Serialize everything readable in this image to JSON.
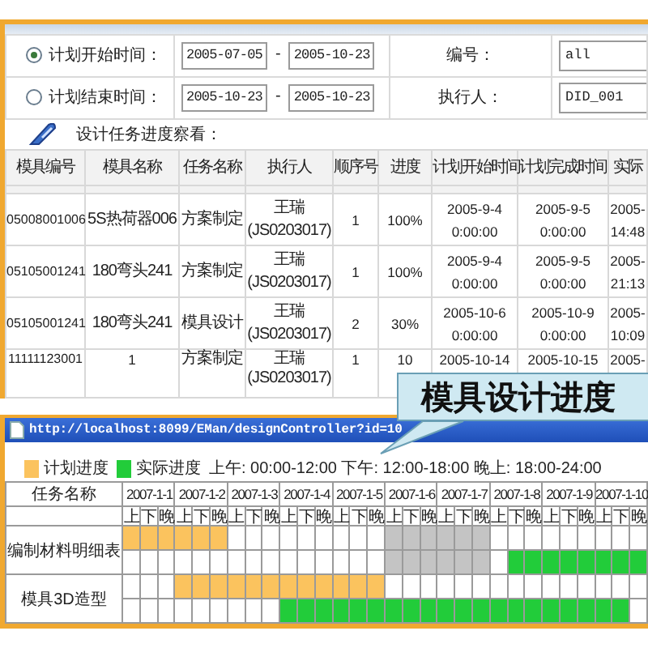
{
  "filters": [
    {
      "label": "计划开始时间：",
      "selected": true,
      "from": "2005-07-05",
      "dash": "-",
      "to": "2005-10-23",
      "field_label": "编号：",
      "field_value": "all"
    },
    {
      "label": "计划结束时间：",
      "selected": false,
      "from": "2005-10-23",
      "dash": "-",
      "to": "2005-10-23",
      "field_label": "执行人：",
      "field_value": "DID_001"
    }
  ],
  "section_title": "设计任务进度察看：",
  "table": {
    "columns": [
      "模具编号",
      "模具名称",
      "任务名称",
      "执行人",
      "顺序号",
      "进度",
      "计划开始时间",
      "计划完成时间",
      "实际"
    ],
    "rows": [
      {
        "clipped": false,
        "cells": [
          "05008001006",
          "5S热荷器006",
          "方案制定",
          "王瑞\n(JS0203017)",
          "1",
          "100%",
          "2005-9-4\n0:00:00",
          "2005-9-5\n0:00:00",
          "2005-\n14:48"
        ]
      },
      {
        "clipped": false,
        "cells": [
          "05105001241",
          "180弯头241",
          "方案制定",
          "王瑞\n(JS0203017)",
          "1",
          "100%",
          "2005-9-4\n0:00:00",
          "2005-9-5\n0:00:00",
          "2005-\n21:13"
        ]
      },
      {
        "clipped": false,
        "cells": [
          "05105001241",
          "180弯头241",
          "模具设计",
          "王瑞\n(JS0203017)",
          "2",
          "30%",
          "2005-10-6\n0:00:00",
          "2005-10-9\n0:00:00",
          "2005-\n10:09"
        ]
      },
      {
        "clipped": true,
        "cells": [
          "11111123001",
          "1",
          "方案制定",
          "王瑞\n(JS0203017)",
          "1",
          "10",
          "2005-10-14",
          "2005-10-15",
          "2005-"
        ]
      }
    ]
  },
  "browser": {
    "url": "http://localhost:8099/EMan/designController?id=10",
    "legend": [
      {
        "label": "计划进度",
        "color": "#fbc35e"
      },
      {
        "label": "实际进度",
        "color": "#22cc3a"
      }
    ],
    "shift_note": "上午: 00:00-12:00 下午: 12:00-18:00 晚上: 18:00-24:00",
    "gantt": {
      "name_header": "任务名称",
      "days": [
        {
          "date": "2007-1-1",
          "weekend": false,
          "slots": [
            "上",
            "下",
            "晚"
          ]
        },
        {
          "date": "2007-1-2",
          "weekend": false,
          "slots": [
            "上",
            "下",
            "晚"
          ]
        },
        {
          "date": "2007-1-3",
          "weekend": false,
          "slots": [
            "上",
            "下",
            "晚"
          ]
        },
        {
          "date": "2007-1-4",
          "weekend": false,
          "slots": [
            "上",
            "下",
            "晚"
          ]
        },
        {
          "date": "2007-1-5",
          "weekend": false,
          "slots": [
            "上",
            "下",
            "晚"
          ]
        },
        {
          "date": "2007-1-6",
          "weekend": true,
          "slots": [
            "上",
            "下",
            "晚"
          ]
        },
        {
          "date": "2007-1-7",
          "weekend": true,
          "slots": [
            "上",
            "下",
            "晚"
          ]
        },
        {
          "date": "2007-1-8",
          "weekend": false,
          "slots": [
            "上",
            "下",
            "晚"
          ]
        },
        {
          "date": "2007-1-9",
          "weekend": false,
          "slots": [
            "上",
            "下",
            "晚"
          ]
        },
        {
          "date": "2007-1-10",
          "weekend": false,
          "slots": [
            "上",
            "下",
            "晚"
          ]
        }
      ],
      "tasks": [
        {
          "name": "编制材料明细表",
          "rows": [
            {
              "kind": "plan",
              "shaded": true,
              "filled": [
                true,
                true,
                true,
                true,
                true,
                true,
                false,
                false,
                false,
                false,
                false,
                false,
                false,
                false,
                false,
                false,
                false,
                false,
                false,
                false,
                false,
                false,
                false,
                false,
                false,
                false,
                false,
                false,
                false,
                false
              ]
            },
            {
              "kind": "actual",
              "shaded": true,
              "filled": [
                false,
                false,
                false,
                false,
                false,
                false,
                false,
                false,
                false,
                false,
                false,
                false,
                false,
                false,
                false,
                false,
                false,
                false,
                false,
                false,
                false,
                false,
                true,
                true,
                true,
                true,
                true,
                true,
                true,
                true
              ]
            }
          ]
        },
        {
          "name": "模具3D造型",
          "rows": [
            {
              "kind": "plan",
              "shaded": false,
              "filled": [
                false,
                false,
                false,
                true,
                true,
                true,
                true,
                true,
                true,
                true,
                true,
                true,
                true,
                true,
                true,
                false,
                false,
                false,
                false,
                false,
                false,
                false,
                false,
                false,
                false,
                false,
                false,
                false,
                false,
                false
              ]
            },
            {
              "kind": "actual",
              "shaded": false,
              "filled": [
                false,
                false,
                false,
                false,
                false,
                false,
                false,
                false,
                false,
                true,
                true,
                true,
                true,
                true,
                true,
                true,
                true,
                true,
                true,
                true,
                true,
                true,
                true,
                true,
                true,
                true,
                true,
                true,
                true,
                false
              ]
            }
          ]
        }
      ]
    }
  },
  "callout": "模具设计进度"
}
